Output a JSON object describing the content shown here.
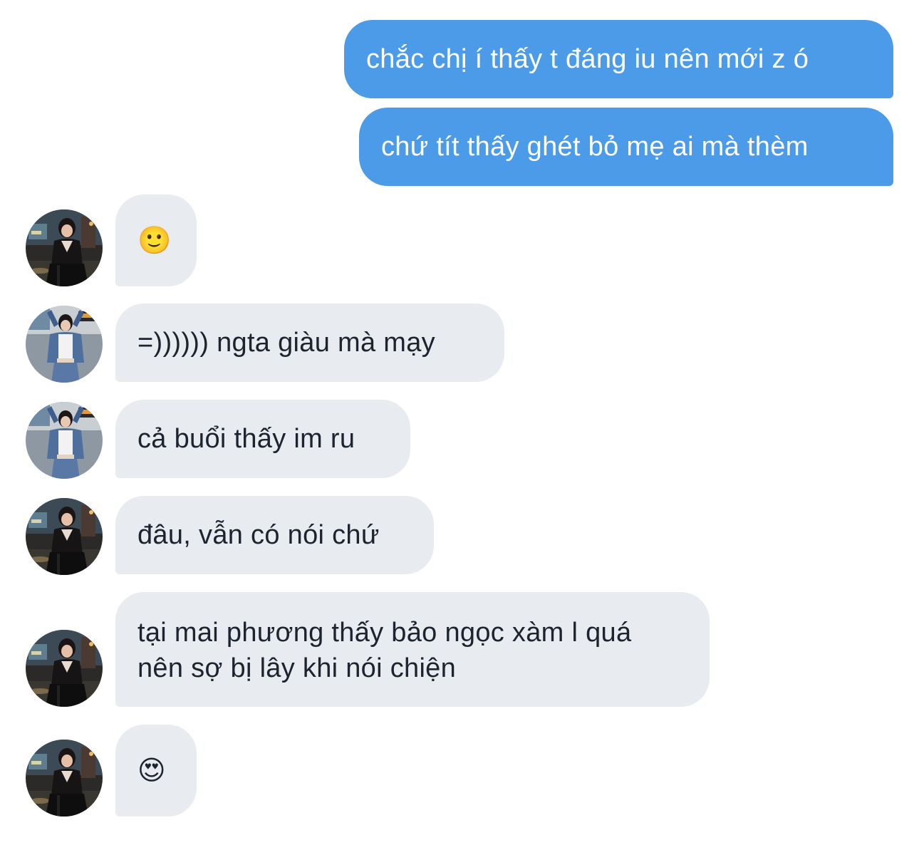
{
  "conversation": {
    "messages": [
      {
        "sender": "me",
        "text": "chắc chị í thấy t đáng iu nên mới z ó"
      },
      {
        "sender": "me",
        "text": "chứ tít thấy ghét bỏ mẹ ai mà thèm"
      },
      {
        "sender": "them",
        "text": "🙂",
        "avatar": "avatar-night-photo"
      },
      {
        "sender": "them",
        "text": "=)))))) ngta giàu mà mạy",
        "avatar": "avatar-denim-jacket"
      },
      {
        "sender": "them",
        "text": "cả buổi thấy im ru",
        "avatar": "avatar-denim-jacket"
      },
      {
        "sender": "them",
        "text": "đâu, vẫn có nói chứ",
        "avatar": "avatar-night-photo"
      },
      {
        "sender": "them",
        "text": "tại mai phương thấy bảo ngọc xàm l quá nên sợ bị lây khi nói chiện",
        "avatar": "avatar-night-photo"
      },
      {
        "sender": "them",
        "text": "😍",
        "avatar": "avatar-night-photo"
      }
    ]
  },
  "colors": {
    "outgoing_bubble": "#4c9be8",
    "incoming_bubble": "#e8ebef",
    "outgoing_text": "#ffffff",
    "incoming_text": "#1d2430"
  }
}
